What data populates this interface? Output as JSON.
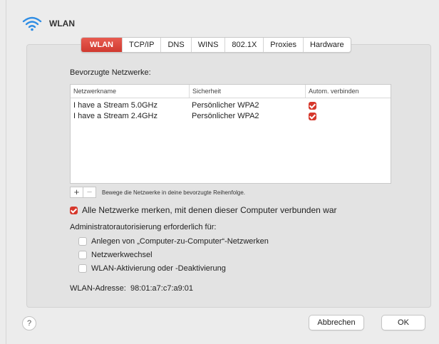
{
  "window": {
    "title": "WLAN"
  },
  "tabs": [
    "WLAN",
    "TCP/IP",
    "DNS",
    "WINS",
    "802.1X",
    "Proxies",
    "Hardware"
  ],
  "preferred": {
    "title": "Bevorzugte Netzwerke:",
    "columns": [
      "Netzwerkname",
      "Sicherheit",
      "Autom. verbinden"
    ],
    "rows": [
      {
        "name": "I have a Stream 5.0GHz",
        "security": "Persönlicher WPA2",
        "auto": true
      },
      {
        "name": "I have a Stream 2.4GHz",
        "security": "Persönlicher WPA2",
        "auto": true
      }
    ],
    "add_label": "+",
    "remove_label": "−",
    "hint": "Bewege die Netzwerke in deine bevorzugte Reihenfolge."
  },
  "remember": {
    "label": "Alle Netzwerke merken, mit denen dieser Computer verbunden war",
    "checked": true
  },
  "admin": {
    "title": "Administratorautorisierung erforderlich für:",
    "options": [
      {
        "label": "Anlegen von „Computer-zu-Computer“-Netzwerken",
        "checked": false
      },
      {
        "label": "Netzwerkwechsel",
        "checked": false
      },
      {
        "label": "WLAN-Aktivierung oder -Deaktivierung",
        "checked": false
      }
    ]
  },
  "address": "WLAN-Adresse:  98:01:a7:c7:a9:01",
  "footer": {
    "help": "?",
    "cancel": "Abbrechen",
    "ok": "OK"
  },
  "colors": {
    "accent": "#d6382c"
  }
}
